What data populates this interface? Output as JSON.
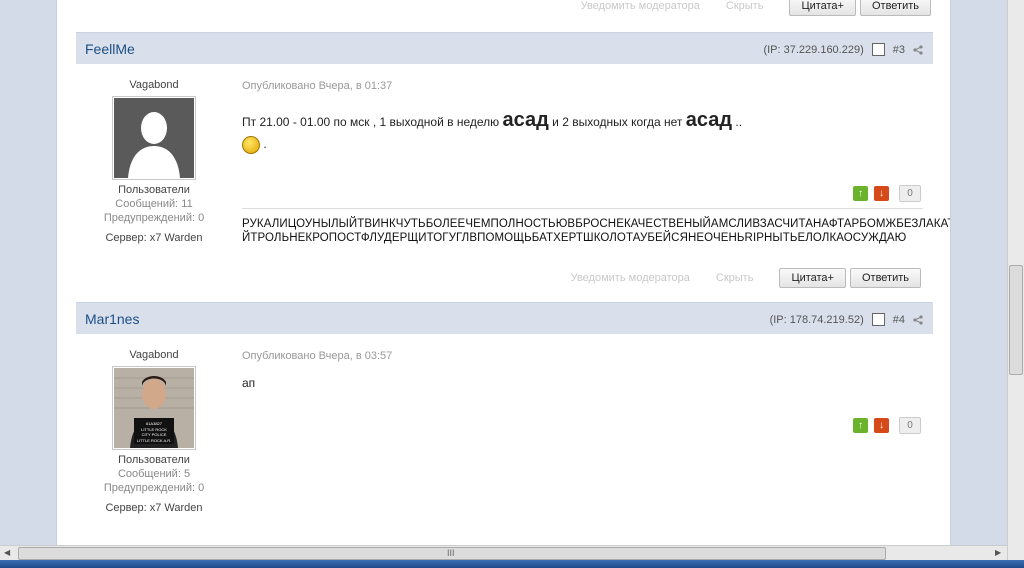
{
  "top_actions": {
    "notify": "Уведомить модератора",
    "hide": "Скрыть",
    "quote": "Цитата+",
    "reply": "Ответить"
  },
  "posts": [
    {
      "author": "FeellMe",
      "ip": "(IP: 37.229.160.229)",
      "number": "#3",
      "rank": "Vagabond",
      "group": "Пользователи",
      "messages": "Сообщений: 11",
      "warnings": "Предупреждений: 0",
      "server": "Сервер: x7 Warden",
      "posted": "Опубликовано Вчера, в 01:37",
      "text_a": "Пт 21.00 - 01.00 по мск , 1 выходной в неделю ",
      "big_a": "асад",
      "text_b": " и 2 выходных когда нет ",
      "big_b": "асад",
      "text_c": " ..",
      "after_emoji": " .",
      "rep_count": "0",
      "sig_line1": "РУКАЛИЦОУНЫЛЫЙТВИНКЧУТЬБОЛЕЕЧЕМПОЛНОСТЬЮВБРОСНЕКАЧЕСТВЕНЫЙАМСЛИВЗАСЧИТАНАФТАРБОМЖБЕЗЛАКАТ",
      "sig_line2": "ЙТРОЛЬНЕКРОПОСТФЛУДЕРЩИТОГУГЛВПОМОЩЬБАТХЕРТШКОЛОТАУБЕЙСЯНЕОЧЕНЬRIРНЫТЬЕЛОЛКАОСУЖДАЮ"
    },
    {
      "author": "Mar1nes",
      "ip": "(IP: 178.74.219.52)",
      "number": "#4",
      "rank": "Vagabond",
      "group": "Пользователи",
      "messages": "Сообщений: 5",
      "warnings": "Предупреждений: 0",
      "server": "Сервер: x7 Warden",
      "posted": "Опубликовано Вчера, в 03:57",
      "text": "ап",
      "rep_count": "0",
      "avatar_text": "61A3827 LITTLE ROCK CITY POLICE LITTLE ROCK A.R."
    }
  ],
  "post_actions": {
    "notify": "Уведомить модератора",
    "hide": "Скрыть",
    "quote": "Цитата+",
    "reply": "Ответить"
  },
  "scroll_grip": "III",
  "colors": {
    "header_bg": "#d9e0ec",
    "author": "#1d4f86",
    "rep_up": "#6bb32a",
    "rep_down": "#d64a1a"
  }
}
